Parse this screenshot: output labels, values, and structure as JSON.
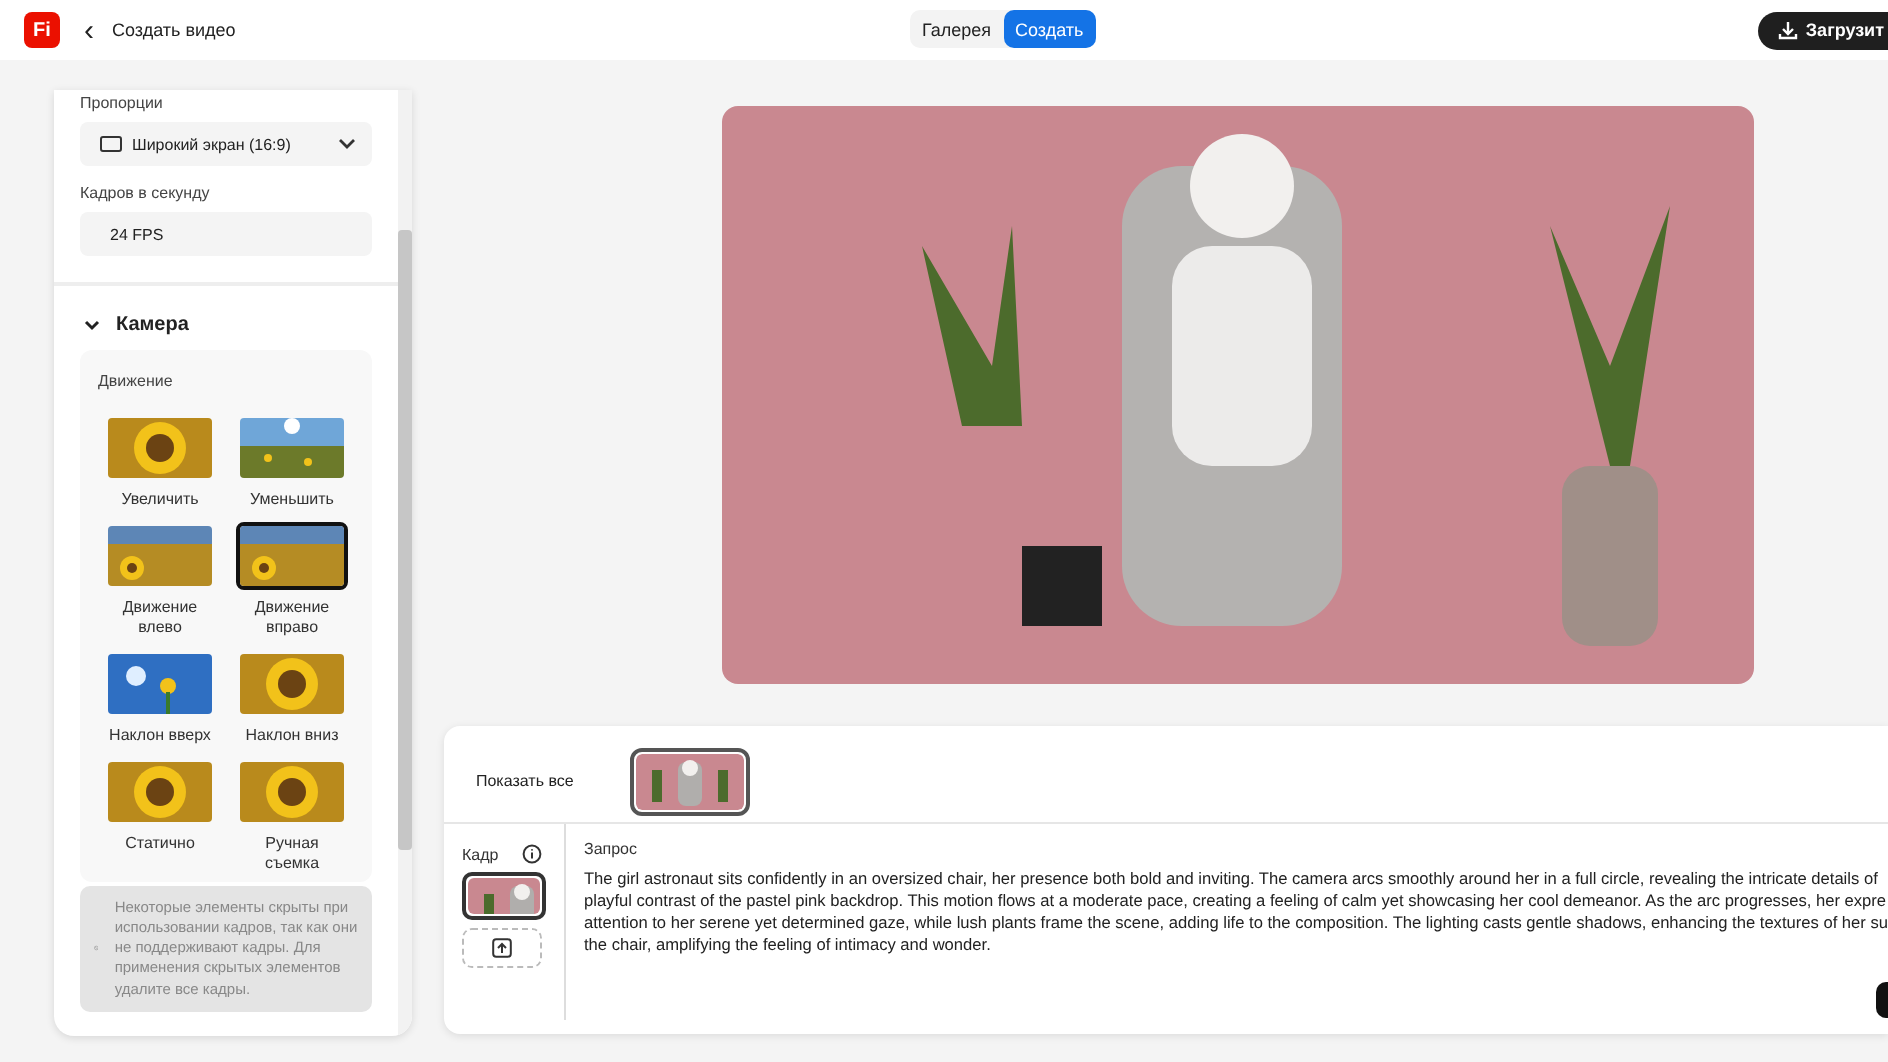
{
  "header": {
    "logo": "Fi",
    "back_icon": "‹",
    "title": "Создать видео",
    "tabs": [
      {
        "label": "Галерея",
        "selected": false
      },
      {
        "label": "Создать",
        "selected": true
      }
    ],
    "download_button": "Загрузит"
  },
  "settings": {
    "aspect_label": "Пропорции",
    "aspect_value": "Широкий экран (16:9)",
    "fps_label": "Кадров в секунду",
    "fps_value": "24 FPS",
    "camera_heading": "Камера",
    "camera_expanded": true,
    "motion_label": "Движение",
    "motions": [
      {
        "label": "Увеличить",
        "kind": "closeup",
        "selected": false
      },
      {
        "label": "Уменьшить",
        "kind": "sky",
        "selected": false
      },
      {
        "label": "Движение влево",
        "kind": "field",
        "selected": false
      },
      {
        "label": "Движение вправо",
        "kind": "field",
        "selected": true
      },
      {
        "label": "Наклон вверх",
        "kind": "blue",
        "selected": false
      },
      {
        "label": "Наклон вниз",
        "kind": "closeup",
        "selected": false
      },
      {
        "label": "Статично",
        "kind": "closeup",
        "selected": false
      },
      {
        "label": "Ручная съемка",
        "kind": "closeup",
        "selected": false
      }
    ],
    "notice": "Некоторые элементы скрыты при использовании кадров, так как они не поддерживают кадры. Для применения скрытых элементов удалите все кадры."
  },
  "frames_bar": {
    "show_all": "Показать все"
  },
  "prompt_panel": {
    "frame_label": "Кадр",
    "prompt_label": "Запрос",
    "prompt_lines": [
      "The girl astronaut sits confidently in an oversized chair, her presence both bold and inviting. The camera arcs smoothly around her in a full circle, revealing the intricate details of",
      "playful contrast of the pastel pink backdrop. This motion flows at a moderate pace, creating a feeling of calm yet showcasing her cool demeanor. As the arc progresses, her expre",
      "attention to her serene yet determined gaze, while lush plants frame the scene, adding life to the composition. The lighting casts gentle shadows, enhancing the textures of her su",
      "the chair, amplifying the feeling of intimacy and wonder."
    ]
  }
}
